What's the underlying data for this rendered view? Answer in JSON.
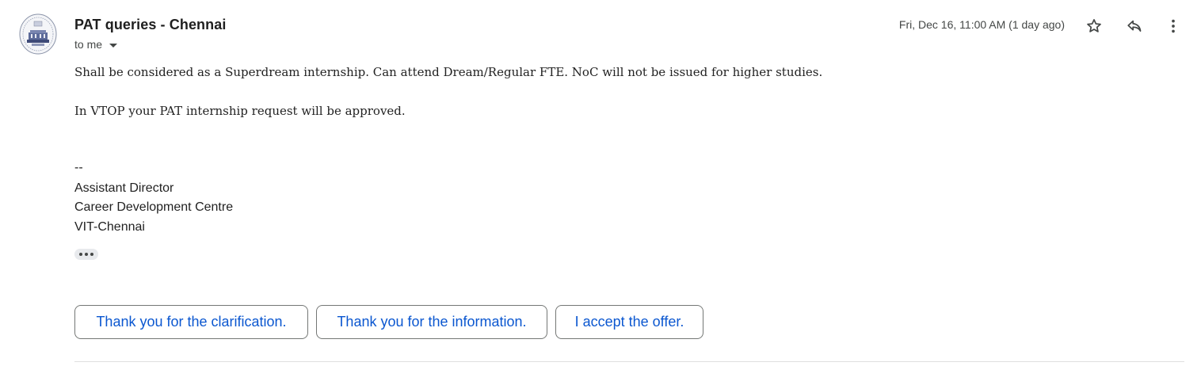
{
  "email": {
    "sender": "PAT queries - Chennai",
    "recipient": "to me",
    "timestamp": "Fri, Dec 16, 11:00 AM (1 day ago)",
    "body": {
      "line1": "Shall be considered as a Superdream internship. Can attend Dream/Regular FTE. NoC will not be issued for higher studies.",
      "line2": "In VTOP your PAT internship request will be approved."
    },
    "signature": {
      "separator": "--",
      "lines": [
        "Assistant Director",
        "Career Development Centre",
        "VIT-Chennai"
      ]
    }
  },
  "icons": {
    "star": "star-icon",
    "reply": "reply-icon",
    "more": "more-vert-icon",
    "recipient_dropdown": "chevron-down-icon",
    "show_trimmed": "ellipsis-icon"
  },
  "smart_replies": [
    "Thank you for the clarification.",
    "Thank you for the information.",
    "I accept the offer."
  ],
  "colors": {
    "accent": "#0b57d0",
    "text": "#1f1f1f",
    "secondary_text": "#444746",
    "border": "#747775"
  }
}
